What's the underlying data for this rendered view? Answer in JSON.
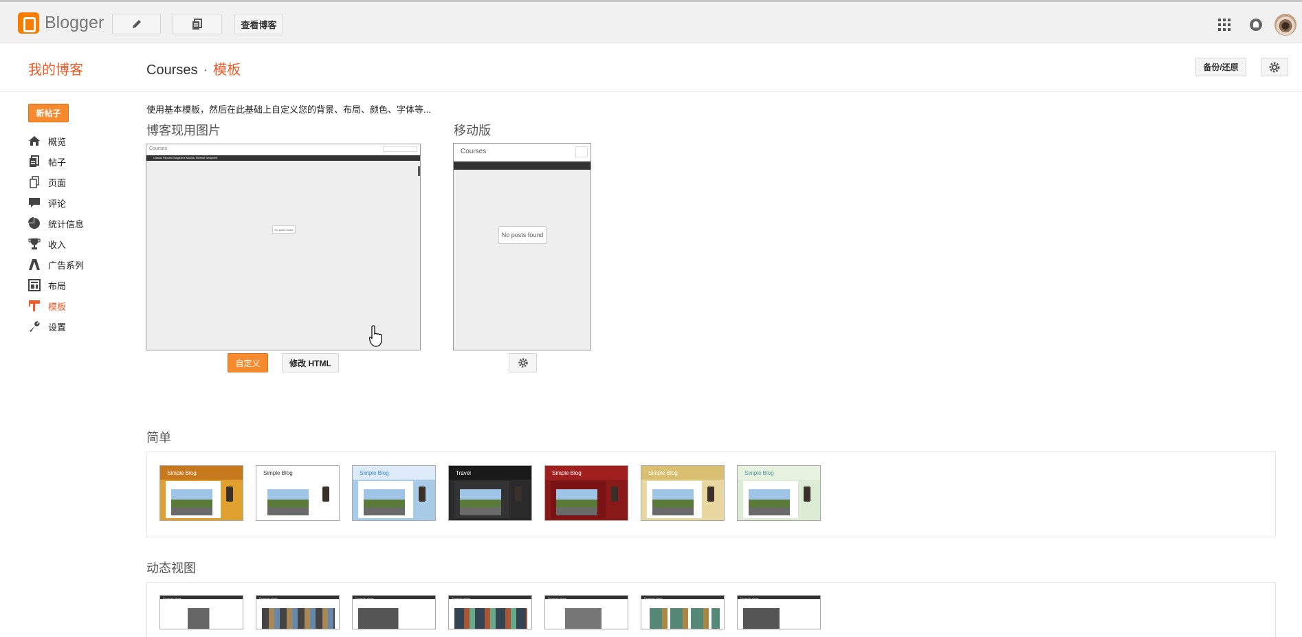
{
  "topbar": {
    "logo_text": "Blogger",
    "view_blog_label": "查看博客"
  },
  "header": {
    "my_blogs_label": "我的博客",
    "blog_name": "Courses",
    "separator": "·",
    "current_page": "模板",
    "backup_restore_label": "备份/还原"
  },
  "sidebar": {
    "new_post_label": "新帖子",
    "items": [
      {
        "label": "概览",
        "icon": "home-icon"
      },
      {
        "label": "帖子",
        "icon": "posts-icon"
      },
      {
        "label": "页面",
        "icon": "pages-icon"
      },
      {
        "label": "评论",
        "icon": "comments-icon"
      },
      {
        "label": "统计信息",
        "icon": "stats-icon"
      },
      {
        "label": "收入",
        "icon": "trophy-icon"
      },
      {
        "label": "广告系列",
        "icon": "adwords-icon"
      },
      {
        "label": "布局",
        "icon": "layout-icon"
      },
      {
        "label": "模板",
        "icon": "template-icon",
        "active": true
      },
      {
        "label": "设置",
        "icon": "wrench-icon"
      }
    ]
  },
  "main": {
    "description": "使用基本模板，然后在此基础上自定义您的背景、布局、颜色、字体等...",
    "current_blog_title": "博客现用图片",
    "mobile_title": "移动版",
    "desktop_preview": {
      "blog_title": "Courses",
      "nav_links": "Classic  Flipcard  Magazine  Mosaic  Sidebar  Snapshot",
      "no_posts": "No posts found"
    },
    "mobile_preview": {
      "blog_title": "Courses",
      "no_posts": "No posts found"
    },
    "customize_label": "自定义",
    "edit_html_label": "修改 HTML",
    "simple_section_title": "简单",
    "dynamic_section_title": "动态视图",
    "simple_themes": [
      {
        "title": "Simple Blog",
        "bg": "#e0a030",
        "header": "#c8781c",
        "title_color": "#fff"
      },
      {
        "title": "Simple Blog",
        "bg": "#ffffff",
        "header": "#ffffff",
        "title_color": "#333"
      },
      {
        "title": "Simple Blog",
        "bg": "#a8cce8",
        "header": "#dcebf7",
        "title_color": "#3a8ad0"
      },
      {
        "title": "Travel",
        "bg": "#2a2a2a",
        "header": "#1a1a1a",
        "title_color": "#fff"
      },
      {
        "title": "Simple Blog",
        "bg": "#8a1a1a",
        "header": "#a02020",
        "title_color": "#fff"
      },
      {
        "title": "Simple Blog",
        "bg": "#e8d8a0",
        "header": "#d8c070",
        "title_color": "#fff"
      },
      {
        "title": "Simple Blog",
        "bg": "#dcebd4",
        "header": "#e8f2e0",
        "title_color": "#4a9a9a"
      }
    ],
    "dynamic_themes": [
      {
        "label": "Dynamic views"
      },
      {
        "label": "Dynamic views"
      },
      {
        "label": "Dynamic views"
      },
      {
        "label": "Dynamic views"
      },
      {
        "label": "Dynamic views"
      },
      {
        "label": "Dynamic views"
      },
      {
        "label": "Dynamic views"
      }
    ]
  }
}
